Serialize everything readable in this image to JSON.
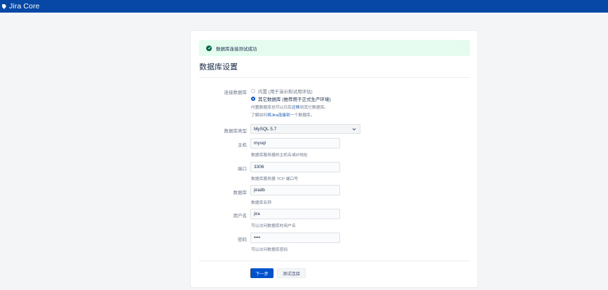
{
  "header": {
    "product": "Jira Core"
  },
  "notice": {
    "message": "数据库连接测试成功"
  },
  "page": {
    "title": "数据库设置"
  },
  "connection": {
    "label": "连接数据库",
    "options": [
      {
        "label": "内置 (用于演示和试用评估)",
        "selected": false
      },
      {
        "label": "其它数据库 (推荐用于正式生产环境)",
        "selected": true
      }
    ],
    "help_prefix": "内置数据库也可以日后",
    "help_link": "迁移",
    "help_suffix": "到其它数据库。",
    "learn_prefix": "了解如何",
    "learn_link": "将Jira连接到",
    "learn_suffix": "一个数据库。"
  },
  "form": {
    "db_type": {
      "label": "数据库类型",
      "value": "MySQL 5.7"
    },
    "host": {
      "label": "主机",
      "value": "mysql",
      "help": "数据库服务器的主机名或IP地址"
    },
    "port": {
      "label": "端口",
      "value": "3306",
      "help": "数据库服务器 TCP 端口号"
    },
    "database": {
      "label": "数据库",
      "value": "jiradb",
      "help": "数据库名称"
    },
    "username": {
      "label": "用户名",
      "value": "jira",
      "help": "可以访问数据库的用户名"
    },
    "password": {
      "label": "密码",
      "value": "••••",
      "help": "可以访问数据库密码"
    }
  },
  "actions": {
    "next": "下一步",
    "test": "测试连接"
  },
  "colors": {
    "brand": "#0747a6",
    "primary": "#0052cc",
    "success_bg": "#e3fcef",
    "success_icon": "#006644"
  }
}
